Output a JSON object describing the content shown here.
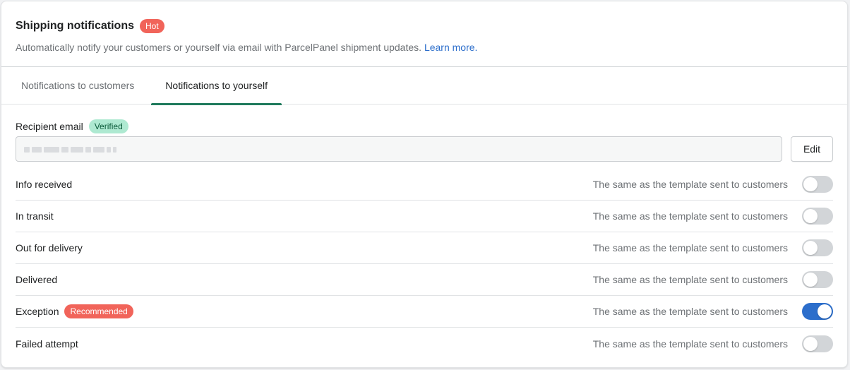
{
  "header": {
    "title": "Shipping notifications",
    "hot_badge": "Hot",
    "description": "Automatically notify your customers or yourself via email with ParcelPanel shipment updates.",
    "learn_more": "Learn more."
  },
  "tabs": [
    {
      "label": "Notifications to customers",
      "active": false
    },
    {
      "label": "Notifications to yourself",
      "active": true
    }
  ],
  "recipient": {
    "label": "Recipient email",
    "verified_badge": "Verified",
    "email_value": "",
    "edit_label": "Edit"
  },
  "rows": [
    {
      "label": "Info received",
      "note": "The same as the template sent to customers",
      "enabled": false
    },
    {
      "label": "In transit",
      "note": "The same as the template sent to customers",
      "enabled": false
    },
    {
      "label": "Out for delivery",
      "note": "The same as the template sent to customers",
      "enabled": false
    },
    {
      "label": "Delivered",
      "note": "The same as the template sent to customers",
      "enabled": false
    },
    {
      "label": "Exception",
      "badge": "Recommended",
      "note": "The same as the template sent to customers",
      "enabled": true
    },
    {
      "label": "Failed attempt",
      "note": "The same as the template sent to customers",
      "enabled": false
    }
  ],
  "colors": {
    "accent_tab": "#1f7a5c",
    "toggle_on": "#2c6ecb",
    "badge_red": "#f1645a",
    "badge_verified": "#aee9d1"
  }
}
